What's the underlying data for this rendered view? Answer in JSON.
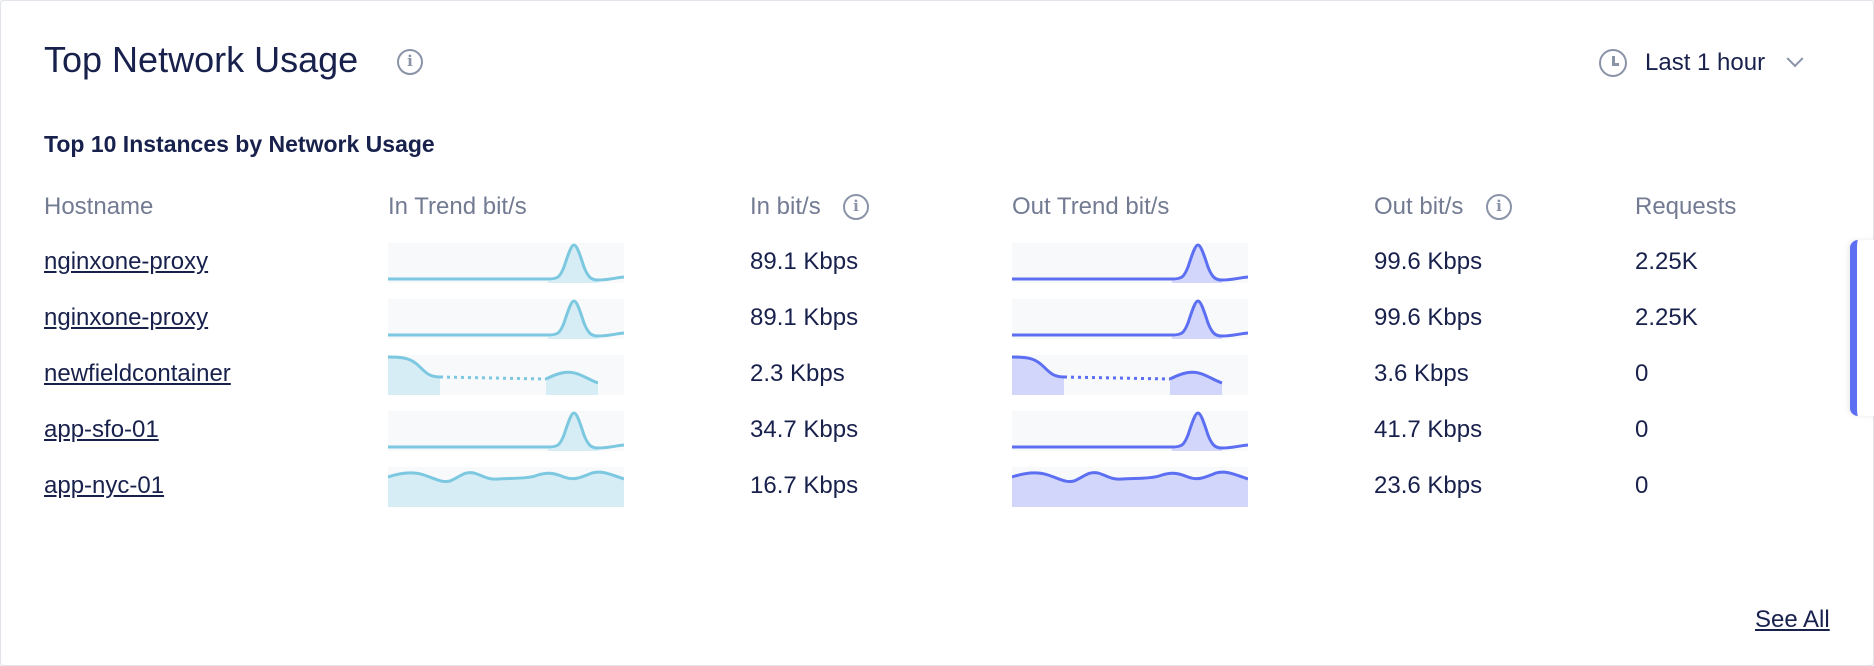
{
  "widget": {
    "title": "Top Network Usage",
    "time_range": "Last 1 hour",
    "subtitle": "Top 10 Instances by Network Usage",
    "see_all": "See All"
  },
  "columns": {
    "hostname": "Hostname",
    "in_trend": "In Trend bit/s",
    "in_bits": "In bit/s",
    "out_trend": "Out Trend bit/s",
    "out_bits": "Out bit/s",
    "requests": "Requests"
  },
  "colors": {
    "in_line": "#7cc8e0",
    "in_fill": "#d6edf5",
    "out_line": "#5c6ef2",
    "out_fill": "#d3d6fb"
  },
  "rows": [
    {
      "hostname": "nginxone-proxy",
      "in_bits": "89.1 Kbps",
      "out_bits": "99.6 Kbps",
      "requests": "2.25K",
      "trend": "spike"
    },
    {
      "hostname": "nginxone-proxy",
      "in_bits": "89.1 Kbps",
      "out_bits": "99.6 Kbps",
      "requests": "2.25K",
      "trend": "spike"
    },
    {
      "hostname": "newfieldcontainer",
      "in_bits": "2.3 Kbps",
      "out_bits": "3.6 Kbps",
      "requests": "0",
      "trend": "gap"
    },
    {
      "hostname": "app-sfo-01",
      "in_bits": "34.7 Kbps",
      "out_bits": "41.7 Kbps",
      "requests": "0",
      "trend": "spike"
    },
    {
      "hostname": "app-nyc-01",
      "in_bits": "16.7 Kbps",
      "out_bits": "23.6 Kbps",
      "requests": "0",
      "trend": "wave"
    }
  ]
}
